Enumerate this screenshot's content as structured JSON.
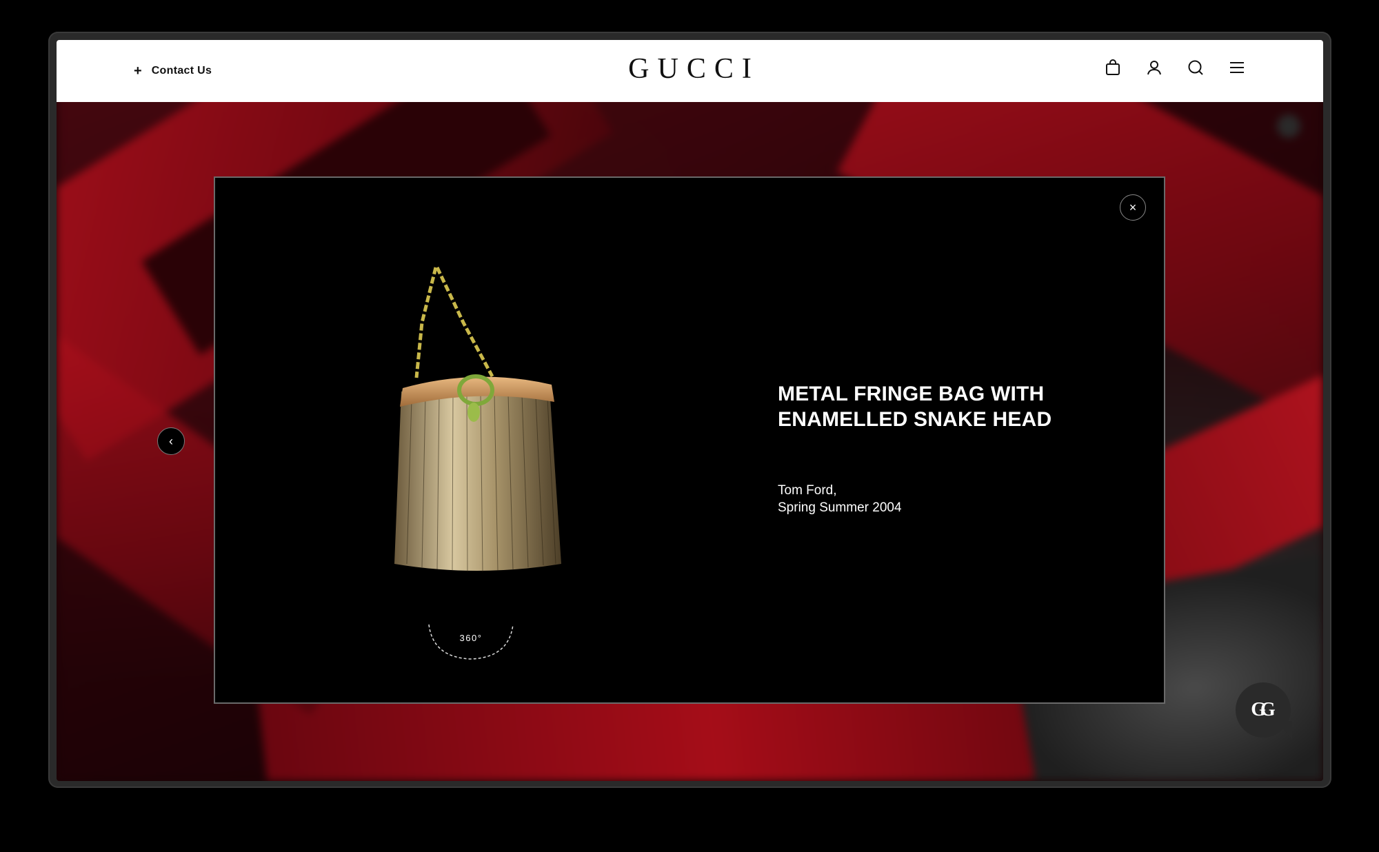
{
  "header": {
    "contact_icon": "plus-icon",
    "contact_label": "Contact Us",
    "logo": "GUCCI",
    "icons": [
      "shopping-bag-icon",
      "account-icon",
      "search-icon",
      "menu-icon"
    ]
  },
  "modal": {
    "close_label": "×",
    "product_title": "METAL FRINGE BAG WITH ENAMELLED SNAKE HEAD",
    "designer": "Tom Ford,",
    "season": "Spring Summer 2004",
    "rotate_label": "360°"
  },
  "nav": {
    "prev_label": "‹"
  },
  "chat": {
    "logo_text": "GG"
  },
  "colors": {
    "accent_red": "#a50d18",
    "header_bg": "#ffffff",
    "modal_bg": "#000000"
  }
}
